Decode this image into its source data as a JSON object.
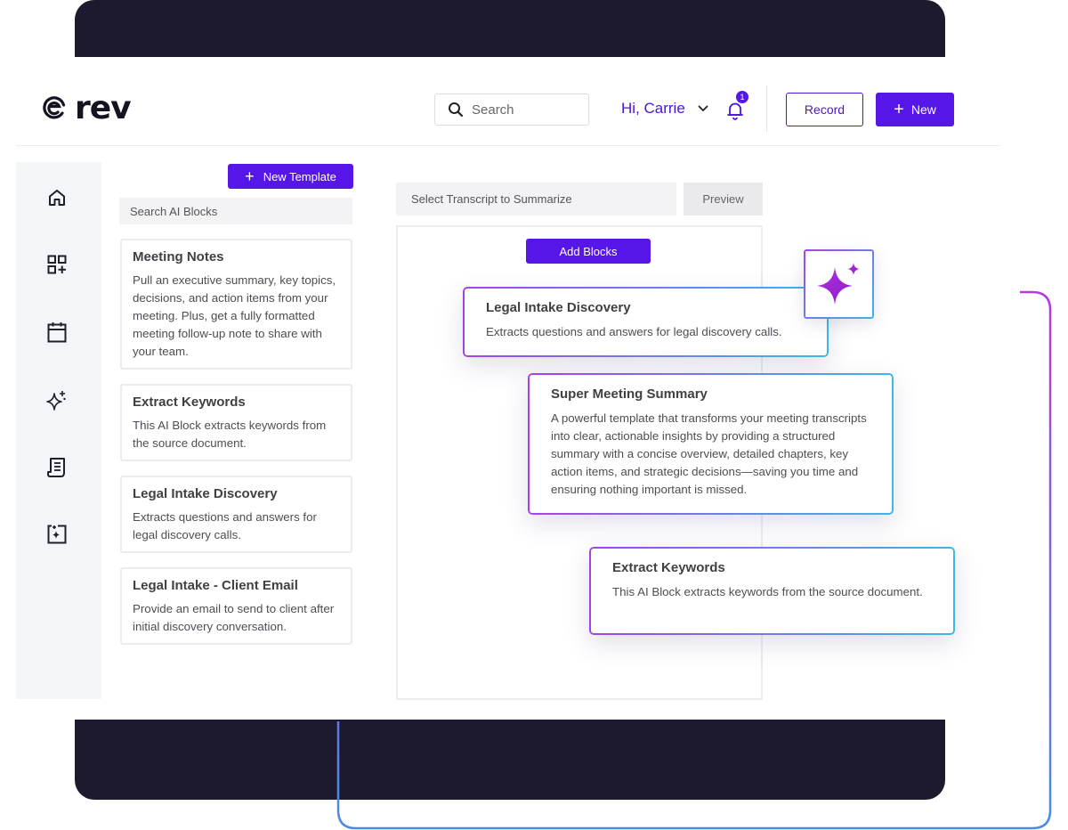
{
  "brand": {
    "name": "rev",
    "logo_icon": "rev-logo-icon"
  },
  "header": {
    "search_placeholder": "Search",
    "greeting": "Hi, Carrie",
    "notification_count": "1",
    "record_label": "Record",
    "new_label": "New"
  },
  "sidebar": {
    "items": [
      {
        "icon": "home-icon"
      },
      {
        "icon": "apps-add-icon"
      },
      {
        "icon": "calendar-icon"
      },
      {
        "icon": "sparkles-icon"
      },
      {
        "icon": "document-icon"
      },
      {
        "icon": "ai-block-icon"
      }
    ]
  },
  "blocks_panel": {
    "new_template_label": "New Template",
    "search_placeholder": "Search AI Blocks",
    "blocks": [
      {
        "title": "Meeting Notes",
        "description": "Pull an executive summary, key topics, decisions, and action items from your meeting. Plus, get a fully formatted meeting follow-up note to share with your team."
      },
      {
        "title": "Extract Keywords",
        "description": "This AI Block extracts keywords from the source document."
      },
      {
        "title": "Legal Intake Discovery",
        "description": "Extracts questions and answers for legal discovery calls."
      },
      {
        "title": "Legal Intake - Client Email",
        "description": "Provide an email to send to client after initial discovery conversation."
      }
    ]
  },
  "builder": {
    "transcript_placeholder": "Select Transcript to Summarize",
    "preview_label": "Preview",
    "add_blocks_label": "Add Blocks",
    "cards": [
      {
        "title": "Legal Intake Discovery",
        "description": "Extracts questions and answers for legal discovery calls."
      },
      {
        "title": "Super Meeting Summary",
        "description": "A powerful template that transforms your meeting transcripts into clear, actionable insights by providing a structured summary with a concise overview, detailed chapters, key action items, and strategic decisions—saving you time and ensuring nothing important is missed."
      },
      {
        "title": "Extract Keywords",
        "description": "This AI Block extracts keywords from the source document."
      }
    ]
  },
  "colors": {
    "accent": "#5716e8",
    "dark": "#1c1a2c",
    "gradient_start": "#a542e6",
    "gradient_end": "#3db6e8"
  }
}
